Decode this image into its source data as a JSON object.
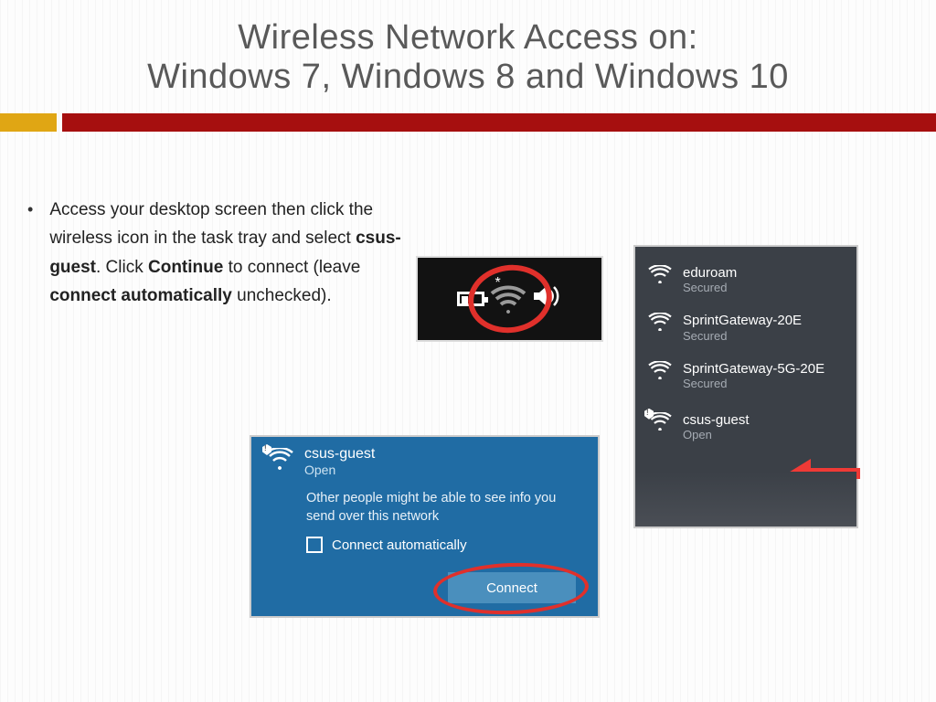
{
  "title_line1": "Wireless Network Access on:",
  "title_line2": "Windows 7, Windows 8 and Windows 10",
  "instruction": {
    "pre": "Access your desktop screen then click the wireless icon in the task tray and select ",
    "b1": "csus-guest",
    "mid1": ". Click ",
    "b2": "Continue",
    "mid2": " to connect (leave ",
    "b3": "connect automatically",
    "post": " unchecked)."
  },
  "connect_panel": {
    "network": "csus-guest",
    "status": "Open",
    "warning": "Other people might be able to see info you send over this network",
    "checkbox_label": "Connect automatically",
    "button": "Connect"
  },
  "wifi_list": [
    {
      "name": "eduroam",
      "status": "Secured",
      "open": false
    },
    {
      "name": "SprintGateway-20E",
      "status": "Secured",
      "open": false
    },
    {
      "name": "SprintGateway-5G-20E",
      "status": "Secured",
      "open": false
    },
    {
      "name": "csus-guest",
      "status": "Open",
      "open": true
    }
  ]
}
